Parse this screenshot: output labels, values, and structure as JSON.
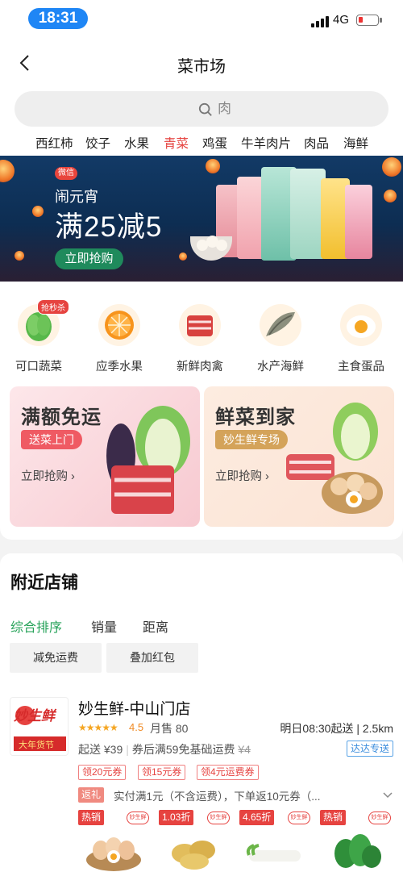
{
  "status_bar": {
    "time": "18:31",
    "network": "4G"
  },
  "header": {
    "title": "菜市场"
  },
  "search": {
    "placeholder": "肉"
  },
  "categories": [
    "西红柿",
    "饺子",
    "水果",
    "青菜",
    "鸡蛋",
    "牛羊肉片",
    "肉品",
    "海鲜"
  ],
  "active_category": "青菜",
  "banner": {
    "logo": "微信",
    "subtitle": "闹元宵",
    "headline": "满25减5",
    "button": "立即抢购"
  },
  "quick_icons": [
    {
      "label": "可口蔬菜",
      "badge": "抢秒杀",
      "icon": "vegetable-icon"
    },
    {
      "label": "应季水果",
      "icon": "orange-icon"
    },
    {
      "label": "新鲜肉禽",
      "icon": "meat-icon"
    },
    {
      "label": "水产海鲜",
      "icon": "fish-icon"
    },
    {
      "label": "主食蛋品",
      "icon": "egg-icon"
    }
  ],
  "promos": [
    {
      "title": "满额免运",
      "tag": "送菜上门",
      "link": "立即抢购 ›"
    },
    {
      "title": "鲜菜到家",
      "tag": "妙生鲜专场",
      "link": "立即抢购 ›"
    }
  ],
  "shops_section": {
    "title": "附近店铺",
    "sort_tabs": [
      "综合排序",
      "销量",
      "距离"
    ],
    "filters": [
      "减免运费",
      "叠加红包"
    ]
  },
  "store": {
    "logo_text": "妙生鲜",
    "logo_sub": "大年货节",
    "name": "妙生鲜-中山门店",
    "stars": "★★★★★",
    "rating": "4.5",
    "monthly_sales": "月售 80",
    "delivery": "明日08:30起送 | 2.5km",
    "min_order": "起送 ¥39",
    "fee_text": "券后满59免基础运费",
    "fee_original": "¥4",
    "express_tag": "达达专送",
    "coupons": [
      "领20元券",
      "领15元券",
      "领4元运费券"
    ],
    "rebate_tag": "返礼",
    "rebate_text": "实付满1元（不含运费），下单返10元券（...",
    "products": [
      {
        "badge": "热销",
        "color": "#e64340",
        "icon": "egg-icon"
      },
      {
        "badge": "1.03折",
        "color": "#e64340",
        "icon": "potato-icon"
      },
      {
        "badge": "4.65折",
        "color": "#e64340",
        "icon": "radish-icon"
      },
      {
        "badge": "热销",
        "color": "#e64340",
        "icon": "spinach-icon"
      }
    ],
    "product_logo": "妙生鲜"
  },
  "colors": {
    "accent_red": "#e64340",
    "accent_green": "#27a35a",
    "time_pill": "#1f86f5"
  }
}
